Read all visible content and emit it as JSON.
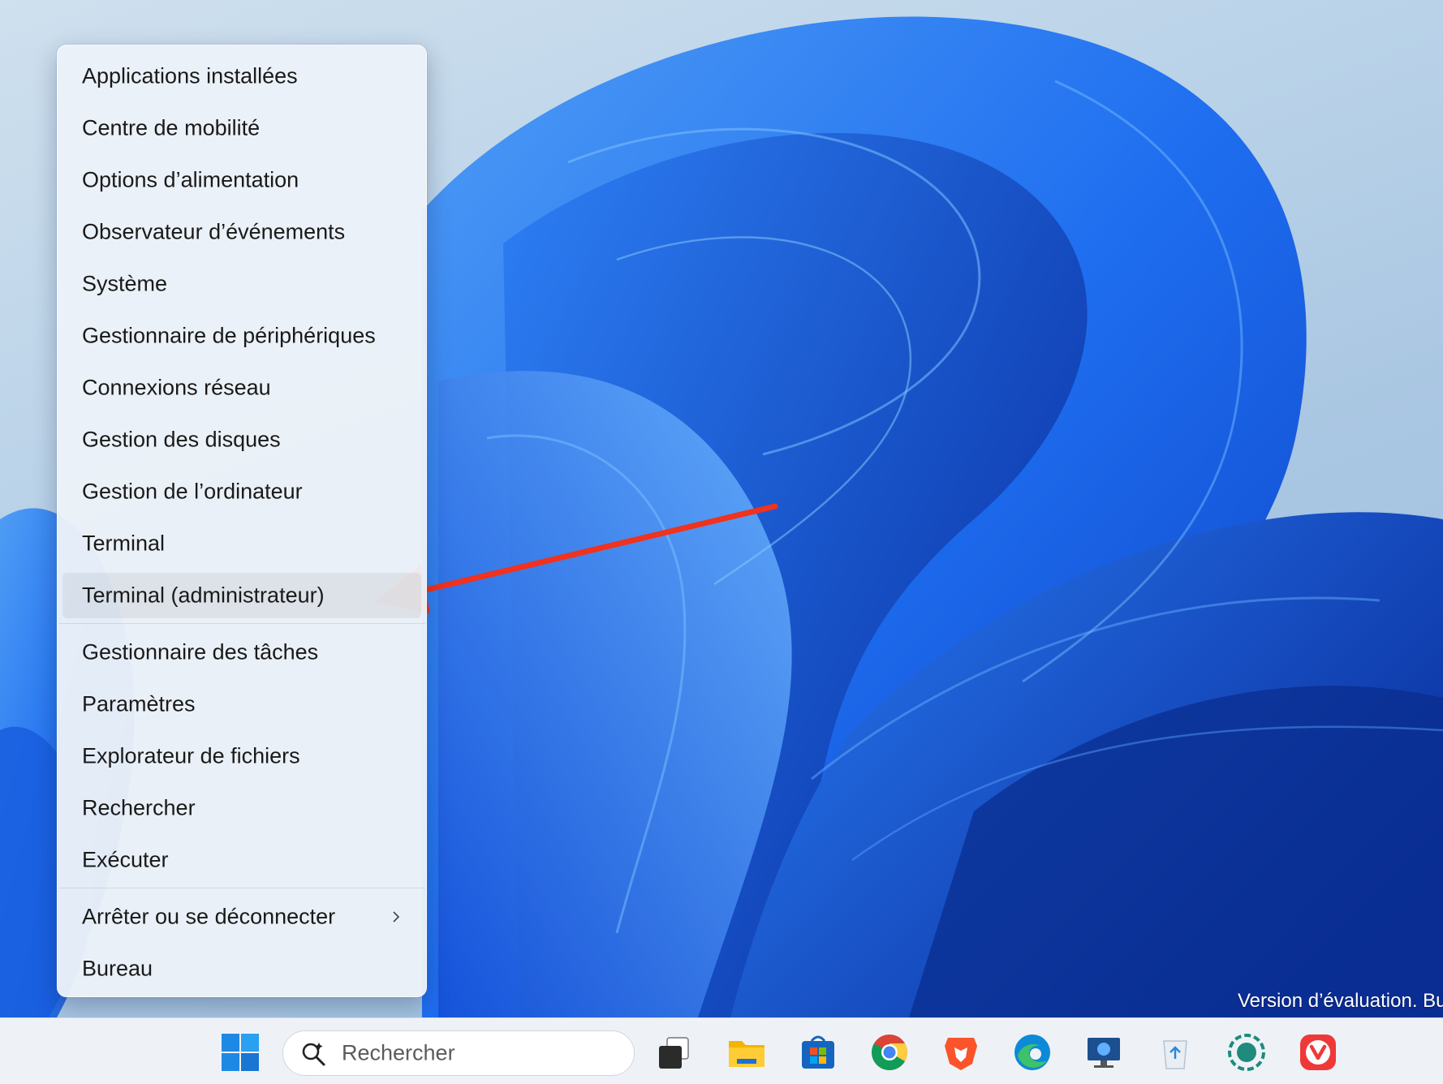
{
  "menu": {
    "items": [
      {
        "label": "Applications installées"
      },
      {
        "label": "Centre de mobilité"
      },
      {
        "label": "Options d’alimentation"
      },
      {
        "label": "Observateur d’événements"
      },
      {
        "label": "Système"
      },
      {
        "label": "Gestionnaire de périphériques"
      },
      {
        "label": "Connexions réseau"
      },
      {
        "label": "Gestion des disques"
      },
      {
        "label": "Gestion de l’ordinateur"
      },
      {
        "label": "Terminal"
      },
      {
        "label": "Terminal (administrateur)"
      },
      {
        "label": "Gestionnaire des tâches"
      },
      {
        "label": "Paramètres"
      },
      {
        "label": "Explorateur de fichiers"
      },
      {
        "label": "Rechercher"
      },
      {
        "label": "Exécuter"
      },
      {
        "label": "Arrêter ou se déconnecter"
      },
      {
        "label": "Bureau"
      }
    ],
    "highlighted_item": "Terminal (administrateur)",
    "submenu_item": "Arrêter ou se déconnecter"
  },
  "desktop": {
    "watermark": "Version d’évaluation. Bu"
  },
  "taskbar": {
    "search_placeholder": "Rechercher",
    "icons": [
      "start-icon",
      "search-icon",
      "task-view-icon",
      "file-explorer-icon",
      "microsoft-store-icon",
      "chrome-icon",
      "brave-icon",
      "edge-icon",
      "remote-desktop-icon",
      "recycle-bin-icon",
      "app-icon",
      "vivaldi-icon"
    ]
  },
  "annotation": {
    "arrow_color": "#f0321e"
  }
}
